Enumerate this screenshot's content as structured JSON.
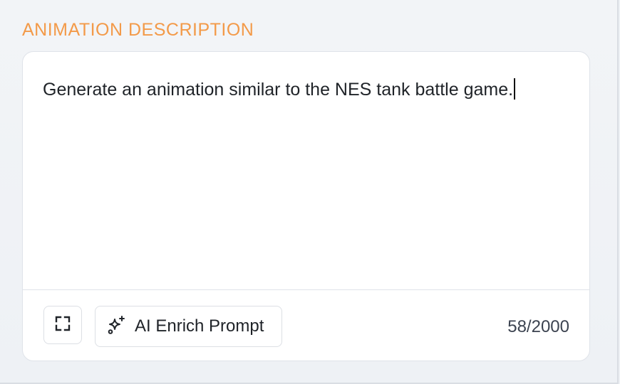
{
  "section": {
    "label": "ANIMATION DESCRIPTION"
  },
  "editor": {
    "text": "Generate an animation similar to the NES tank battle game.",
    "char_count": "58/2000"
  },
  "toolbar": {
    "expand_icon": "expand-icon",
    "enrich_icon": "sparkle-icon",
    "enrich_label": "AI Enrich Prompt"
  },
  "colors": {
    "accent": "#f39a49",
    "text": "#1f2328",
    "border": "#dfe3e9",
    "background": "#eef1f5"
  }
}
